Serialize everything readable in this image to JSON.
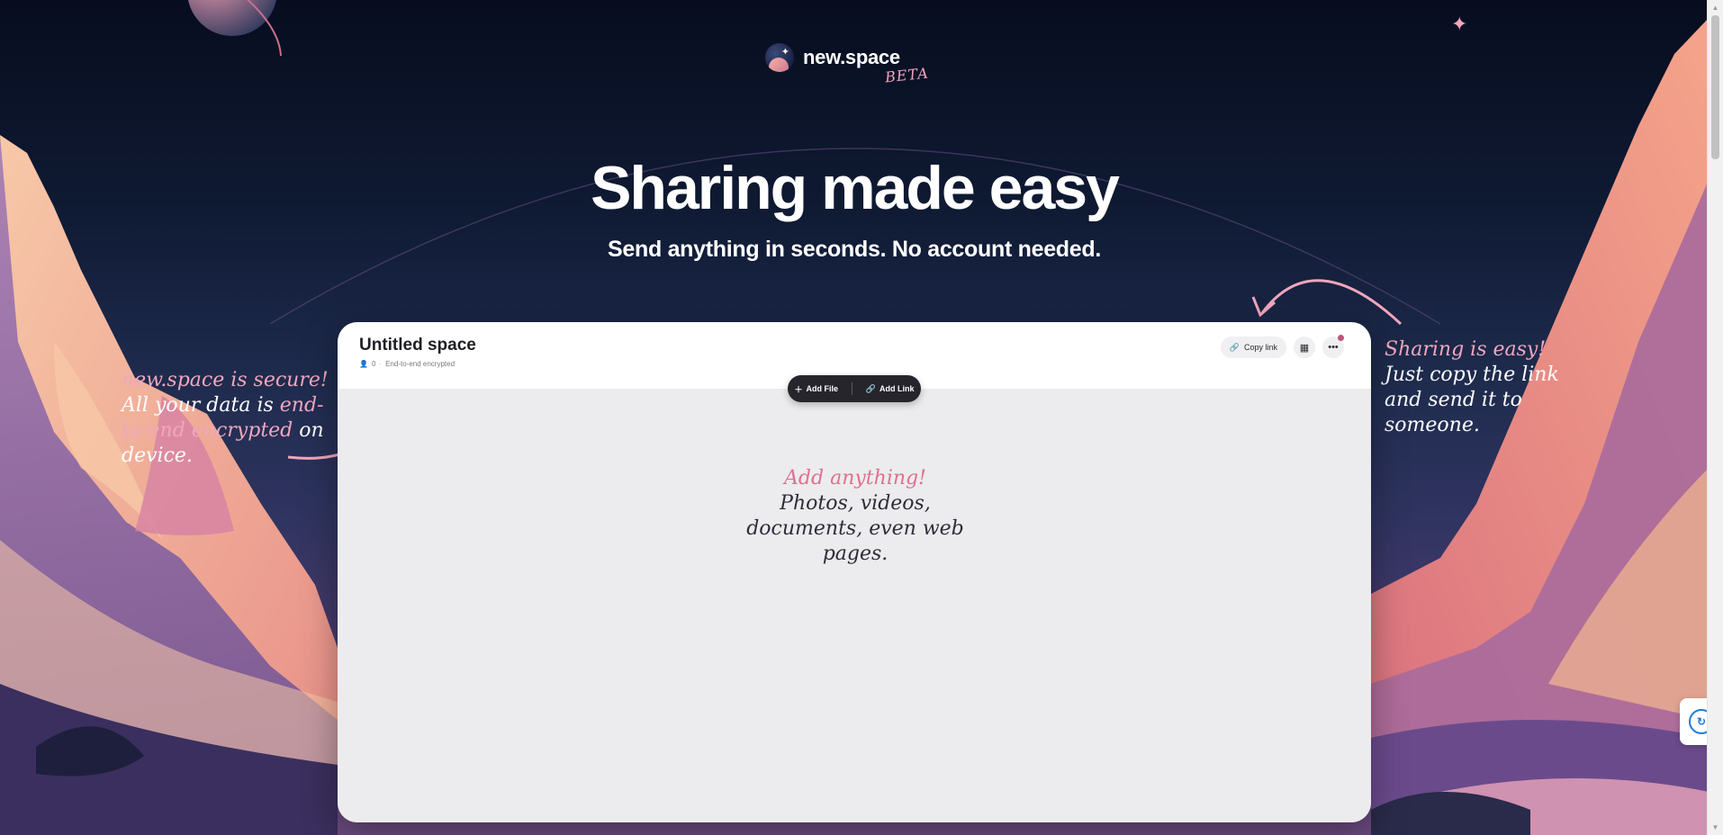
{
  "brand": {
    "name": "new.space",
    "badge": "BETA"
  },
  "hero": {
    "title": "Sharing made easy",
    "subtitle": "Send anything in seconds. No account needed."
  },
  "notes": {
    "left": {
      "highlight": "new.space is secure!",
      "line_a": "All your data is ",
      "highlight2": "end-to-end encrypted",
      "line_b": " on device."
    },
    "right": {
      "highlight": "Sharing is easy!",
      "text": "Just copy the link and send it to someone."
    },
    "center": {
      "highlight": "Add anything!",
      "text": "Photos, videos, documents, even web pages."
    }
  },
  "space": {
    "title": "Untitled space",
    "members": "0",
    "encryption": "End-to-end encrypted",
    "copy_link": "Copy link",
    "add_file": "Add File",
    "add_link": "Add Link"
  },
  "icons": [
    "logo-icon",
    "user-icon",
    "link-icon",
    "qr-code-icon",
    "more-icon",
    "plus-icon",
    "widget-icon"
  ],
  "colors": {
    "accent_pink": "#f2a6bd",
    "toolbar_dark": "#25252b",
    "notify": "#c0547a"
  }
}
